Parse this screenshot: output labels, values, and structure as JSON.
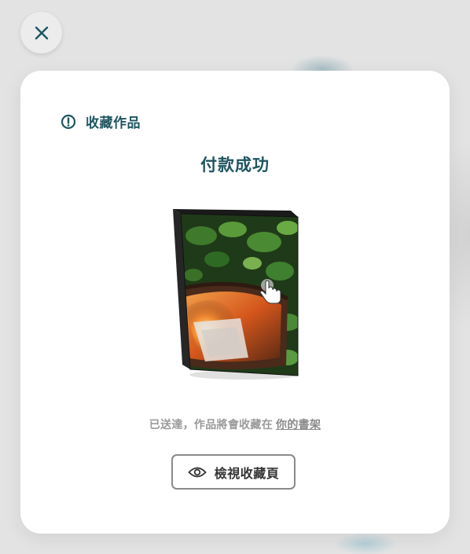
{
  "close": {
    "icon": "close-icon"
  },
  "modal": {
    "header_icon": "info-circle-icon",
    "header_title": "收藏作品",
    "status_title": "付款成功",
    "book": {
      "cover_icon": "tap-hand-icon"
    },
    "note_text": "已送達，作品將會收藏在",
    "note_link": "你的書架",
    "view_button": {
      "icon": "eye-icon",
      "label": "檢視收藏頁"
    }
  },
  "colors": {
    "accent": "#1f5560",
    "muted_text": "#9a9a9a",
    "backdrop": "#e3e3e3"
  }
}
